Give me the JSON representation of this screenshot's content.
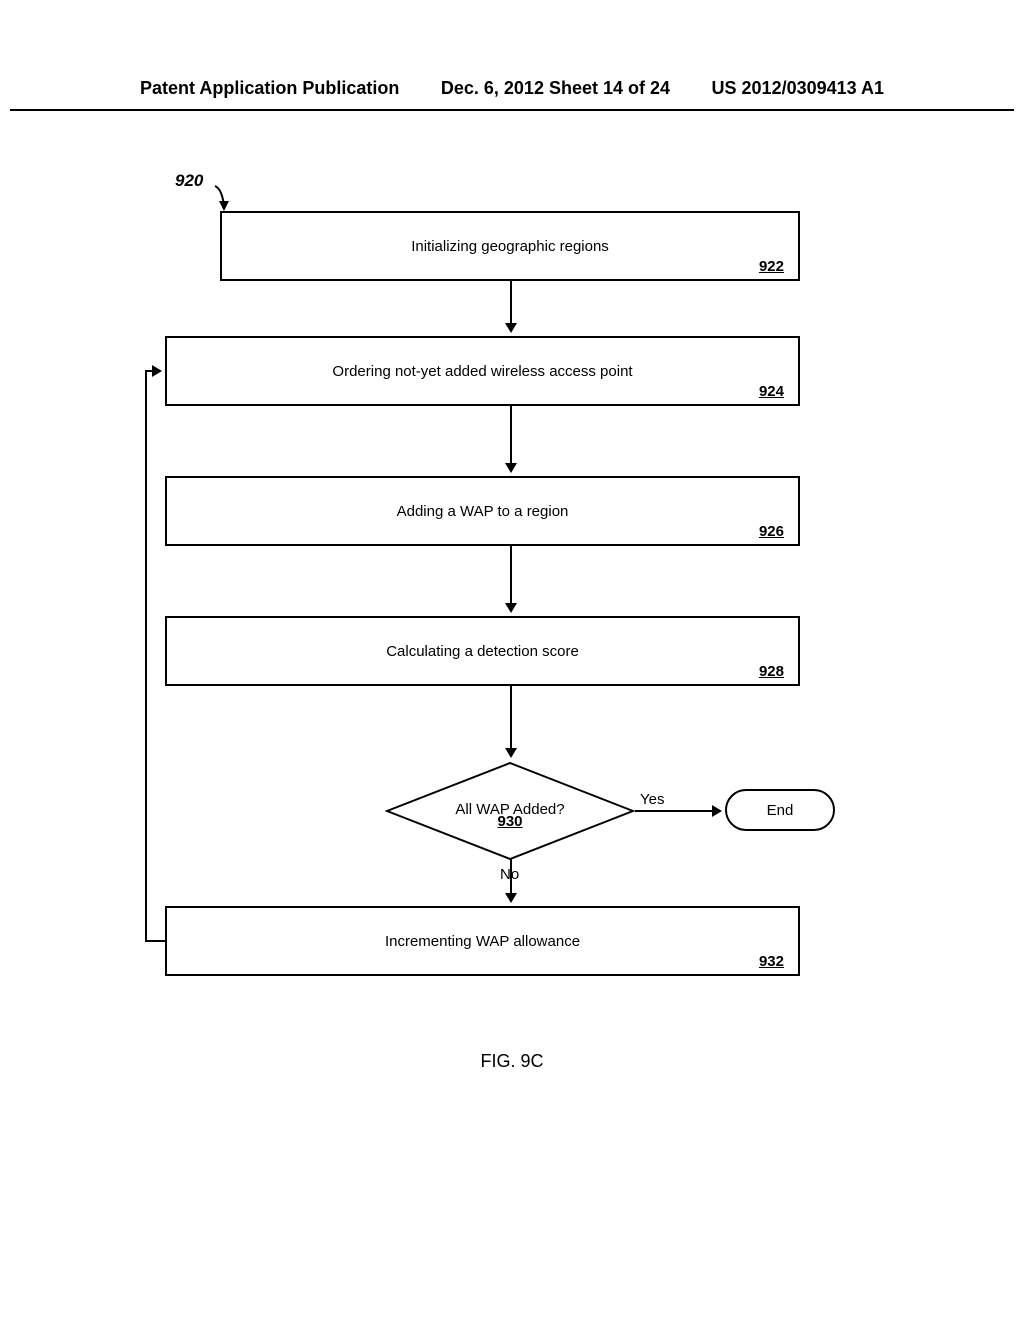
{
  "header": {
    "left": "Patent Application Publication",
    "center": "Dec. 6, 2012  Sheet 14 of 24",
    "right": "US 2012/0309413 A1"
  },
  "flowchart": {
    "ref_label": "920",
    "boxes": {
      "b922": {
        "text": "Initializing geographic regions",
        "ref": "922"
      },
      "b924": {
        "text": "Ordering  not-yet added wireless access point",
        "ref": "924"
      },
      "b926": {
        "text": "Adding a WAP to a region",
        "ref": "926"
      },
      "b928": {
        "text": "Calculating a detection score",
        "ref": "928"
      },
      "b932": {
        "text": "Incrementing WAP allowance",
        "ref": "932"
      }
    },
    "decision": {
      "text": "All WAP Added?",
      "ref": "930"
    },
    "terminator": {
      "text": "End"
    },
    "labels": {
      "yes": "Yes",
      "no": "No"
    }
  },
  "caption": "FIG. 9C"
}
